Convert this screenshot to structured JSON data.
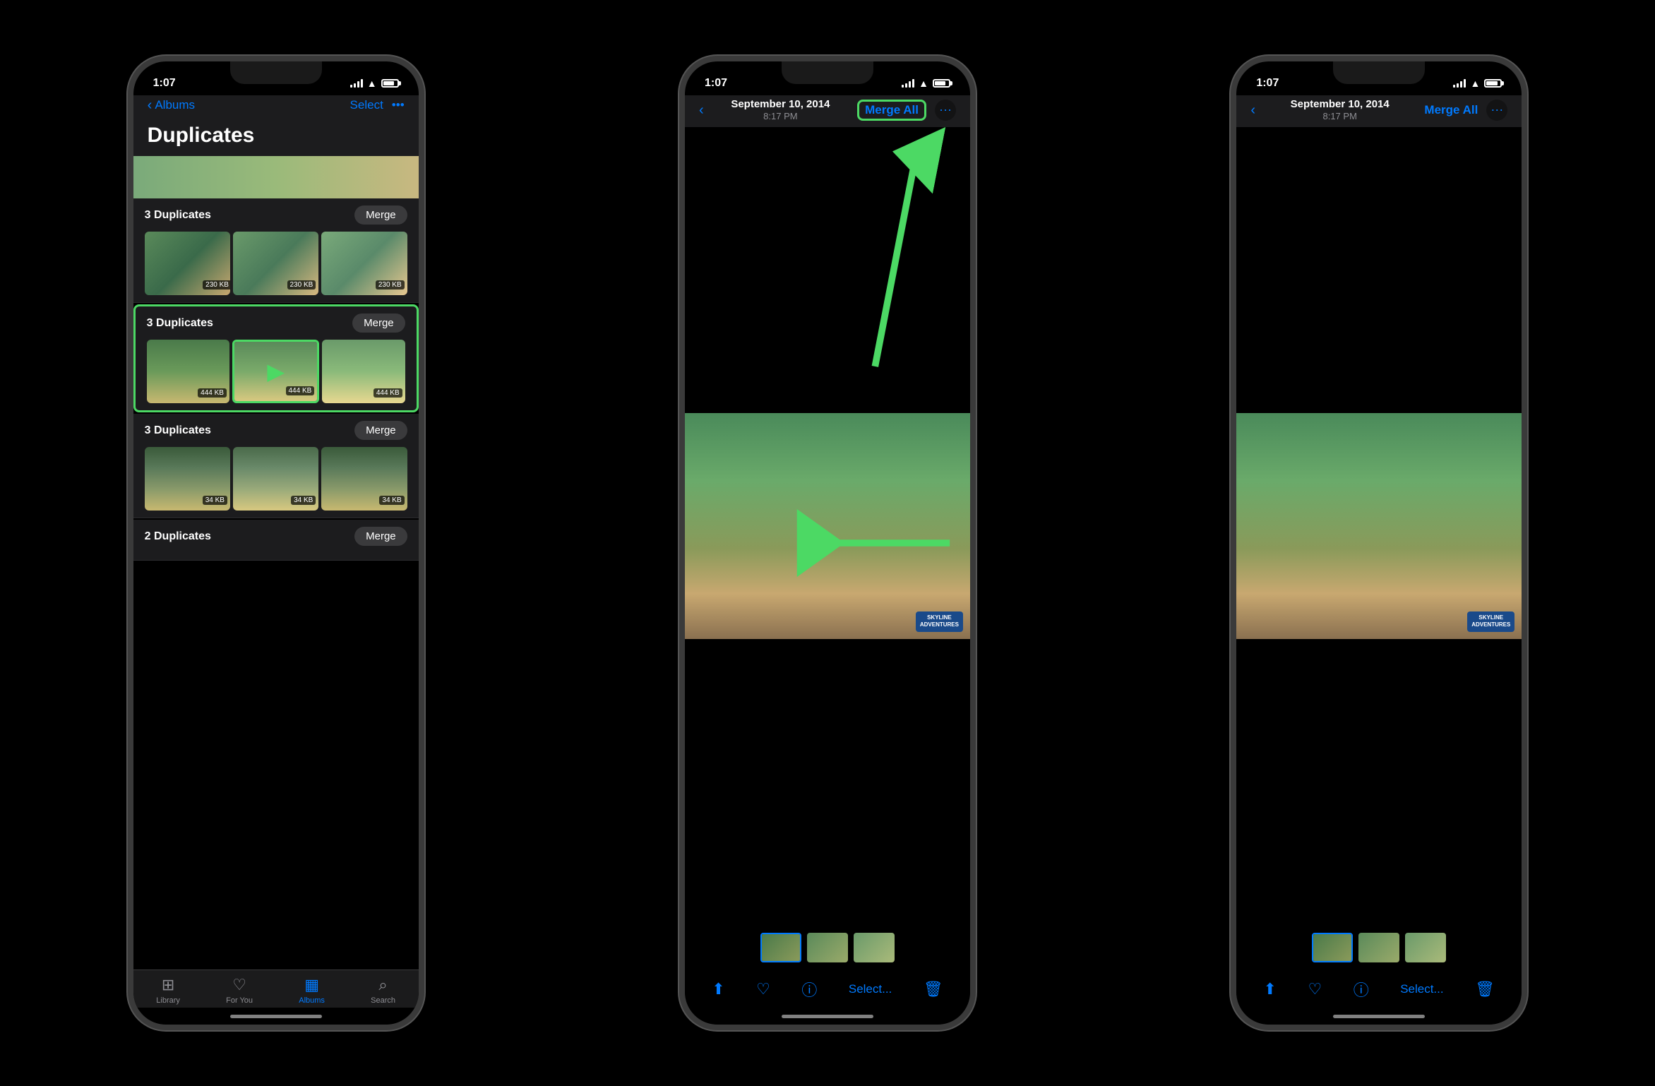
{
  "phone1": {
    "statusTime": "1:07",
    "navBack": "Albums",
    "navSelect": "Select",
    "navMore": "•••",
    "pageTitle": "Duplicates",
    "groups": [
      {
        "count": "3 Duplicates",
        "mergeLabel": "Merge",
        "photos": [
          {
            "size": "230 KB"
          },
          {
            "size": "230 KB"
          },
          {
            "size": "230 KB"
          }
        ]
      },
      {
        "count": "3 Duplicates",
        "mergeLabel": "Merge",
        "highlighted": true,
        "photos": [
          {
            "size": "444 KB"
          },
          {
            "size": "444 KB",
            "highlighted": true
          },
          {
            "size": "444 KB"
          }
        ]
      },
      {
        "count": "3 Duplicates",
        "mergeLabel": "Merge",
        "photos": [
          {
            "size": "34 KB"
          },
          {
            "size": "34 KB"
          },
          {
            "size": "34 KB"
          }
        ]
      },
      {
        "count": "2 Duplicates",
        "mergeLabel": "Merge",
        "photos": []
      }
    ],
    "tabs": [
      {
        "label": "Library",
        "icon": "📷",
        "active": false
      },
      {
        "label": "For You",
        "icon": "❤️",
        "active": false
      },
      {
        "label": "Albums",
        "icon": "▦",
        "active": true
      },
      {
        "label": "Search",
        "icon": "🔍",
        "active": false
      }
    ]
  },
  "phone2": {
    "statusTime": "1:07",
    "navDate": "September 10, 2014",
    "navTime": "8:17 PM",
    "mergeAllLabel": "Merge All",
    "moreLabel": "⊕",
    "actions": [
      "share",
      "heart",
      "info",
      "Select...",
      "delete"
    ]
  },
  "phone3": {
    "statusTime": "1:07",
    "navDate": "September 10, 2014",
    "navTime": "8:17 PM",
    "mergeAllLabel": "Merge All",
    "moreLabel": "⊕",
    "actions": [
      "share",
      "heart",
      "info",
      "Select...",
      "delete"
    ]
  },
  "colors": {
    "accent": "#007AFF",
    "green": "#4CD964",
    "dark": "#1c1c1e",
    "black": "#000000"
  }
}
